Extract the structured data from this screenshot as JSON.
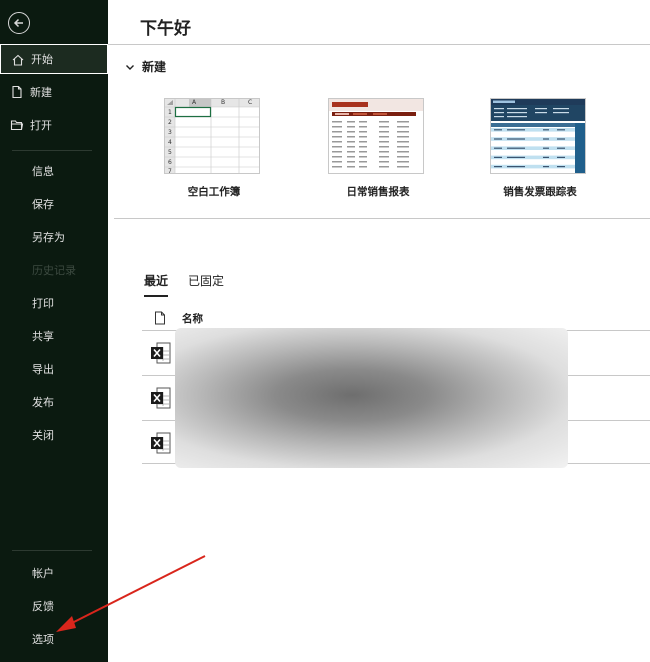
{
  "sidebar": {
    "top_items": [
      {
        "label": "开始",
        "icon": "home-icon",
        "active": true
      },
      {
        "label": "新建",
        "icon": "new-document-icon"
      },
      {
        "label": "打开",
        "icon": "open-folder-icon"
      }
    ],
    "sub_items": [
      {
        "label": "信息"
      },
      {
        "label": "保存"
      },
      {
        "label": "另存为"
      },
      {
        "label": "历史记录",
        "disabled": true
      },
      {
        "label": "打印"
      },
      {
        "label": "共享"
      },
      {
        "label": "导出"
      },
      {
        "label": "发布"
      },
      {
        "label": "关闭"
      }
    ],
    "bottom_items": [
      {
        "label": "帐户"
      },
      {
        "label": "反馈"
      },
      {
        "label": "选项"
      }
    ]
  },
  "main": {
    "greeting": "下午好",
    "new_section_title": "新建",
    "templates": [
      {
        "caption": "空白工作簿"
      },
      {
        "caption": "日常销售报表"
      },
      {
        "caption": "销售发票跟踪表"
      }
    ],
    "grid_thumb": {
      "columns": [
        "A",
        "B",
        "C"
      ],
      "rows": [
        "1",
        "2",
        "3",
        "4",
        "5",
        "6",
        "7"
      ]
    },
    "tabs": [
      {
        "label": "最近",
        "active": true
      },
      {
        "label": "已固定"
      }
    ],
    "file_list_header": "名称",
    "file_rows": 3
  },
  "colors": {
    "sidebar_bg": "#0b1a10",
    "excel_green": "#1d6f42",
    "arrow_red": "#d9261c"
  }
}
